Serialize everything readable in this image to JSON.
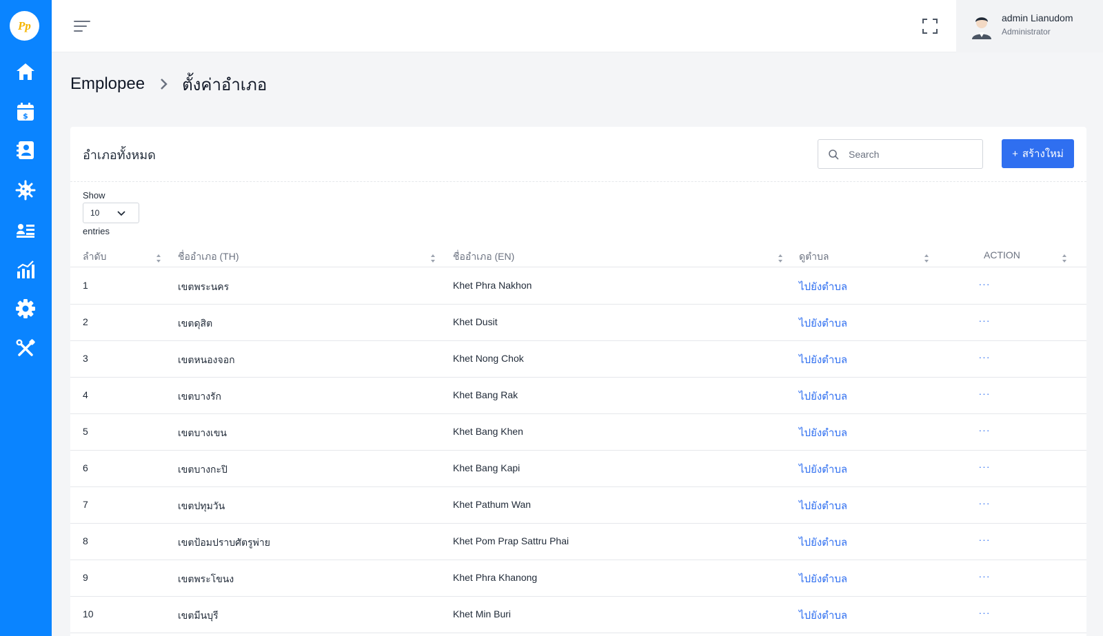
{
  "app": {
    "logo_text": "Pp"
  },
  "sidebar": {
    "items": [
      {
        "icon": "home-icon"
      },
      {
        "icon": "calendar-dollar-icon"
      },
      {
        "icon": "contact-book-icon"
      },
      {
        "icon": "virus-icon"
      },
      {
        "icon": "user-list-icon"
      },
      {
        "icon": "bar-chart-icon"
      },
      {
        "icon": "gear-icon"
      },
      {
        "icon": "tools-icon",
        "active": true
      }
    ]
  },
  "user": {
    "name": "admin Lianudom",
    "role": "Administrator"
  },
  "breadcrumb": {
    "root": "Emplopee",
    "current": "ตั้งค่าอำเภอ"
  },
  "card": {
    "title": "อำเภอทั้งหมด",
    "search_placeholder": "Search",
    "create_label": "สร้างใหม่",
    "create_symbol": "+"
  },
  "length": {
    "show_label": "Show",
    "value": "10",
    "entries_label": "entries"
  },
  "table": {
    "columns": [
      "ลำดับ",
      "ชื่ออำเภอ (TH)",
      "ชื่ออำเภอ (EN)",
      "ดูตำบล",
      "ACTION"
    ],
    "rows": [
      {
        "no": "1",
        "th": "เขตพระนคร",
        "en": "Khet Phra Nakhon",
        "link": "ไปยังตำบล"
      },
      {
        "no": "2",
        "th": "เขตดุสิต",
        "en": "Khet Dusit",
        "link": "ไปยังตำบล"
      },
      {
        "no": "3",
        "th": "เขตหนองจอก",
        "en": "Khet Nong Chok",
        "link": "ไปยังตำบล"
      },
      {
        "no": "4",
        "th": "เขตบางรัก",
        "en": "Khet Bang Rak",
        "link": "ไปยังตำบล"
      },
      {
        "no": "5",
        "th": "เขตบางเขน",
        "en": "Khet Bang Khen",
        "link": "ไปยังตำบล"
      },
      {
        "no": "6",
        "th": "เขตบางกะปิ",
        "en": "Khet Bang Kapi",
        "link": "ไปยังตำบล"
      },
      {
        "no": "7",
        "th": "เขตปทุมวัน",
        "en": "Khet Pathum Wan",
        "link": "ไปยังตำบล"
      },
      {
        "no": "8",
        "th": "เขตป้อมปราบศัตรูพ่าย",
        "en": "Khet Pom Prap Sattru Phai",
        "link": "ไปยังตำบล"
      },
      {
        "no": "9",
        "th": "เขตพระโขนง",
        "en": "Khet Phra Khanong",
        "link": "ไปยังตำบล"
      },
      {
        "no": "10",
        "th": "เขตมีนบุรี",
        "en": "Khet Min Buri",
        "link": "ไปยังตำบล"
      }
    ],
    "action_symbol": "···"
  },
  "colors": {
    "sidebar": "#0a84ff",
    "primary": "#2f6ff0",
    "background": "#f4f5f7"
  }
}
